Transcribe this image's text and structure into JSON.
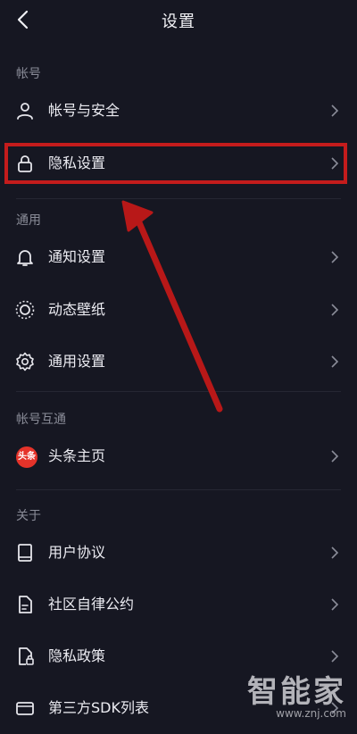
{
  "header": {
    "title": "设置",
    "back_icon": "chevron-left-icon"
  },
  "sections": [
    {
      "label": "帐号"
    },
    {
      "label": "通用"
    },
    {
      "label": "帐号互通"
    },
    {
      "label": "关于"
    }
  ],
  "rows": {
    "account_security": {
      "label": "帐号与安全",
      "icon": "person-icon"
    },
    "privacy": {
      "label": "隐私设置",
      "icon": "lock-icon"
    },
    "notifications": {
      "label": "通知设置",
      "icon": "bell-icon"
    },
    "live_wallpaper": {
      "label": "动态壁纸",
      "icon": "wallpaper-icon"
    },
    "general": {
      "label": "通用设置",
      "icon": "gear-icon"
    },
    "toutiao": {
      "label": "头条主页",
      "icon": "toutiao-logo-icon",
      "badge_text": "头条"
    },
    "user_agreement": {
      "label": "用户协议",
      "icon": "book-icon"
    },
    "community": {
      "label": "社区自律公约",
      "icon": "document-icon"
    },
    "privacy_policy": {
      "label": "隐私政策",
      "icon": "document-lock-icon"
    },
    "third_party_sdk": {
      "label": "第三方SDK列表",
      "icon": "wallet-icon"
    }
  },
  "annotation": {
    "highlight_color": "#c41c1c"
  },
  "watermark": {
    "name": "智能家",
    "url": "www.znj.com"
  }
}
